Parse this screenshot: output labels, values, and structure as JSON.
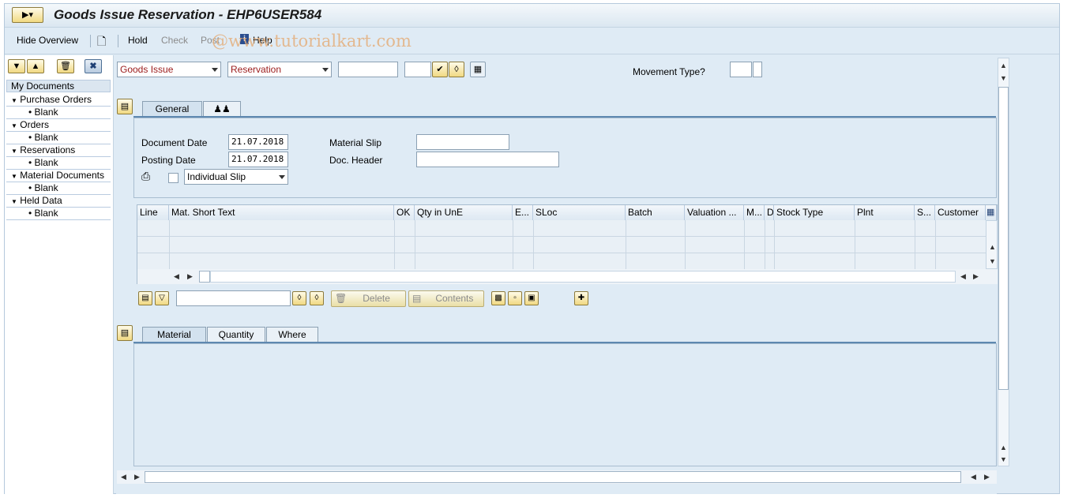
{
  "window": {
    "title": "Goods Issue Reservation - EHP6USER584",
    "menu_button_icon": "command-menu-icon"
  },
  "watermark": "@www.tutorialkart.com",
  "toolbar": {
    "hide_overview": "Hide Overview",
    "hold": "Hold",
    "check": "Check",
    "post": "Post",
    "help": "Help"
  },
  "left_pane": {
    "header": "My Documents",
    "tree": [
      {
        "label": "Purchase Orders",
        "child": "Blank"
      },
      {
        "label": "Orders",
        "child": "Blank"
      },
      {
        "label": "Reservations",
        "child": "Blank"
      },
      {
        "label": "Material Documents",
        "child": "Blank"
      },
      {
        "label": "Held Data",
        "child": "Blank"
      }
    ]
  },
  "header_bar": {
    "action": "Goods Issue",
    "reference": "Reservation",
    "reference_value": "",
    "item_value": "",
    "movement_type_label": "Movement Type?",
    "movement_type_value": ""
  },
  "general_tab": {
    "tabs": [
      "General"
    ],
    "document_date_label": "Document Date",
    "document_date": "21.07.2018",
    "posting_date_label": "Posting Date",
    "posting_date": "21.07.2018",
    "material_slip_label": "Material Slip",
    "material_slip": "",
    "doc_header_label": "Doc. Header",
    "doc_header": "",
    "print_option": "Individual Slip"
  },
  "grid": {
    "columns": [
      "Line",
      "Mat. Short Text",
      "OK",
      "Qty in UnE",
      "E...",
      "SLoc",
      "Batch",
      "Valuation ...",
      "M...",
      "D",
      "Stock Type",
      "Plnt",
      "S...",
      "Customer"
    ]
  },
  "grid_toolbar": {
    "search_value": "",
    "delete": "Delete",
    "contents": "Contents"
  },
  "detail_tabs": [
    "Material",
    "Quantity",
    "Where"
  ],
  "colors": {
    "background": "#dfebf5",
    "title_text": "#1a1a1a",
    "dropdown_text": "#9b1b1b",
    "tab_accent": "#5e88b0"
  }
}
